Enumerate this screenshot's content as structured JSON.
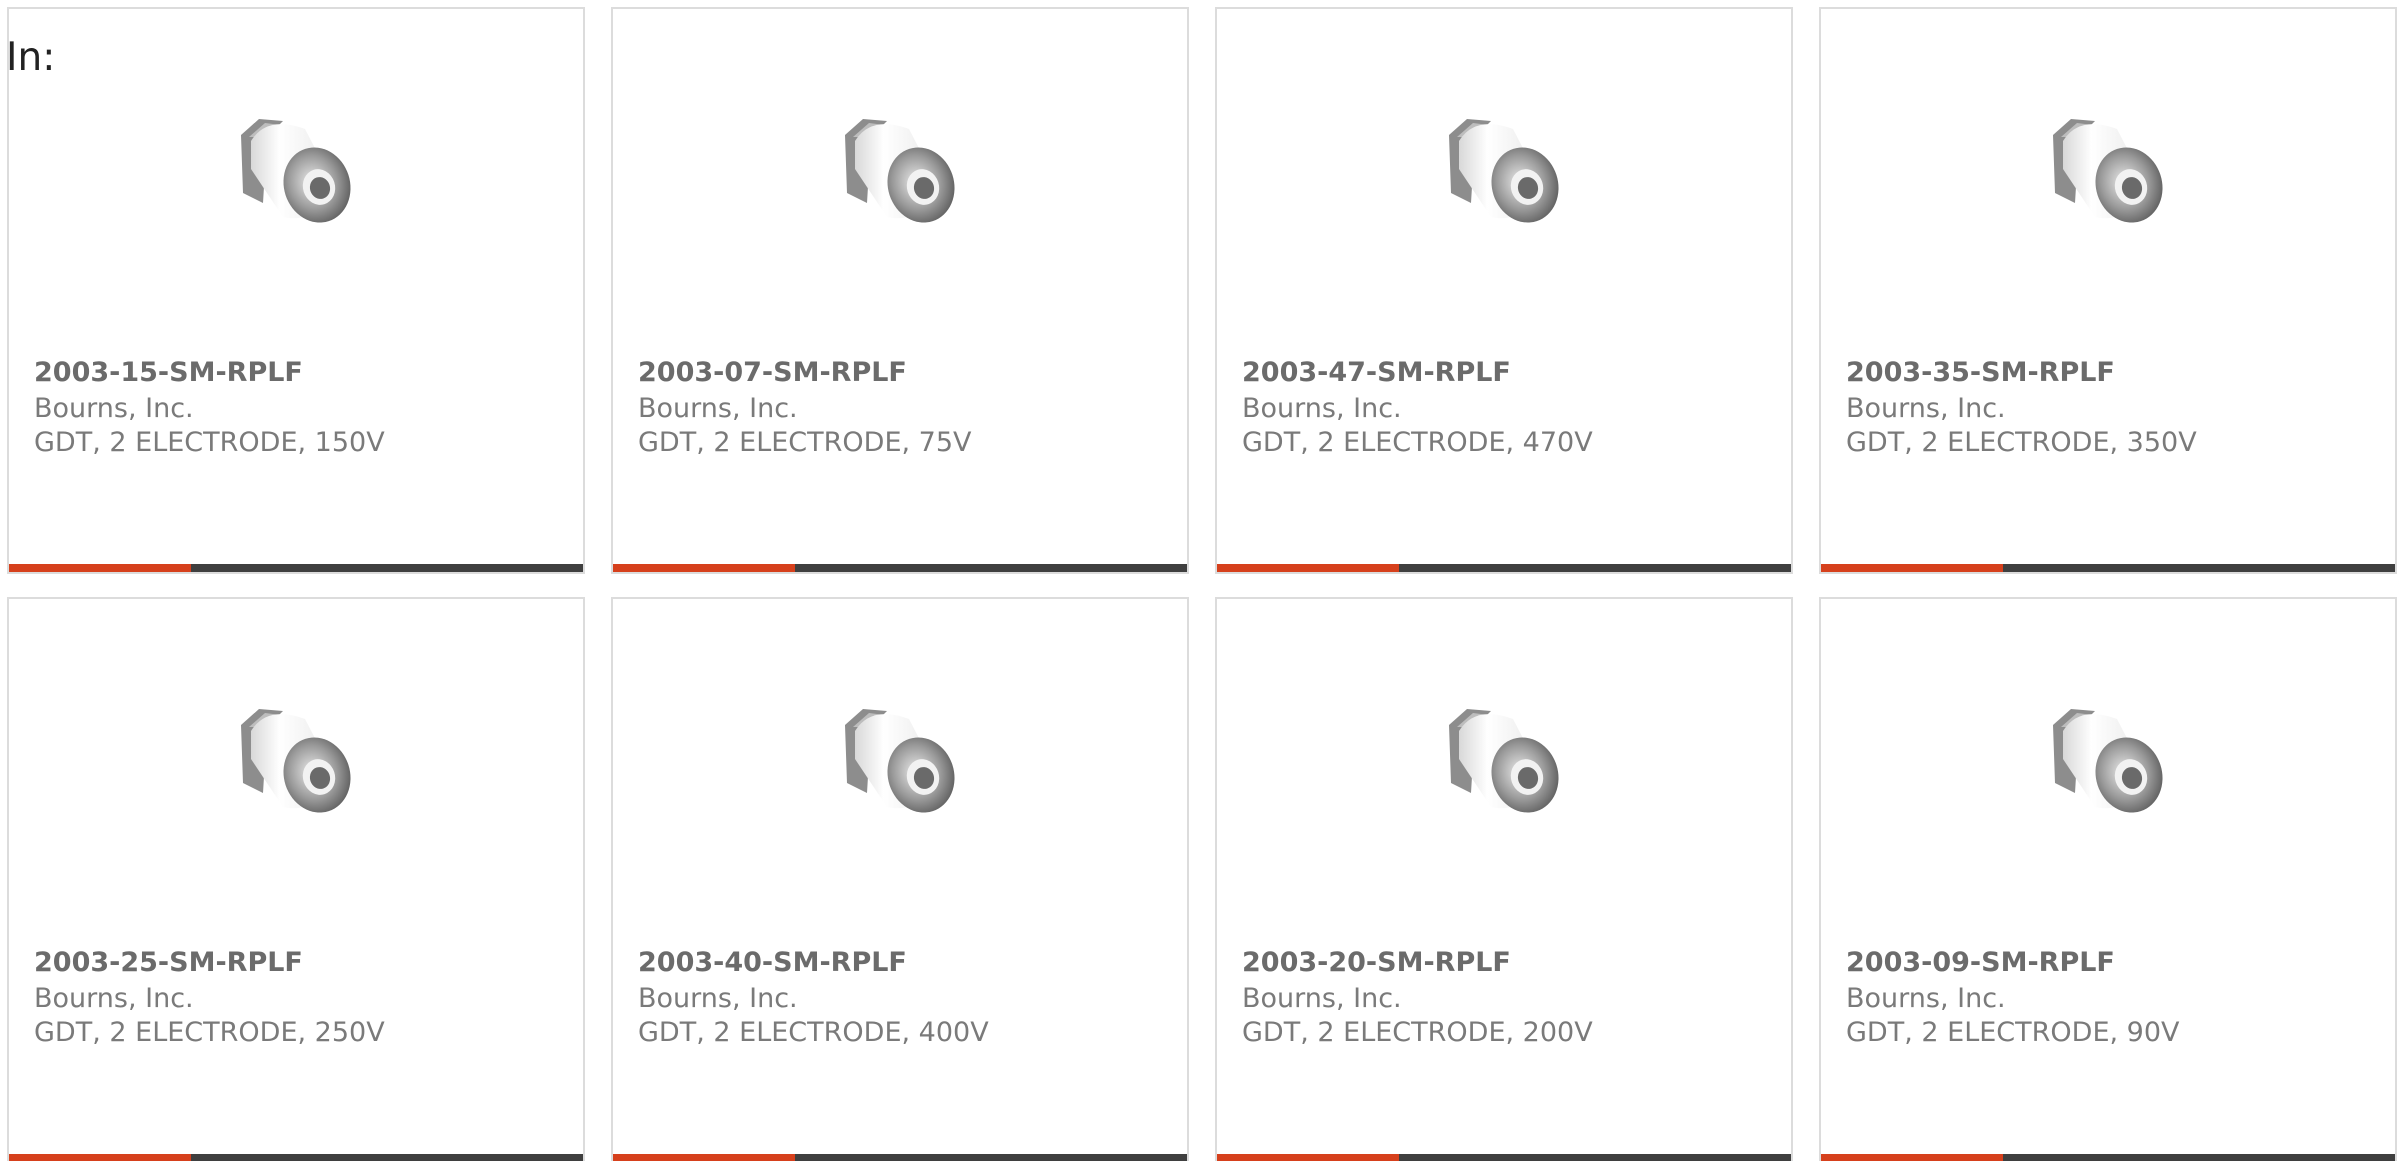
{
  "header": {
    "label": "In:"
  },
  "colors": {
    "accent_bar": "#d6401c",
    "bar": "#3f3f3f",
    "border": "#dcdcdc",
    "part_number_text": "#6b6b6b",
    "body_text": "#7a7a7a"
  },
  "products": [
    {
      "part_number": "2003-15-SM-RPLF",
      "manufacturer": "Bourns, Inc.",
      "description": "GDT, 2 ELECTRODE, 150V",
      "icon": "gas-discharge-tube-icon"
    },
    {
      "part_number": "2003-07-SM-RPLF",
      "manufacturer": "Bourns, Inc.",
      "description": "GDT, 2 ELECTRODE, 75V",
      "icon": "gas-discharge-tube-icon"
    },
    {
      "part_number": "2003-47-SM-RPLF",
      "manufacturer": "Bourns, Inc.",
      "description": "GDT, 2 ELECTRODE, 470V",
      "icon": "gas-discharge-tube-icon"
    },
    {
      "part_number": "2003-35-SM-RPLF",
      "manufacturer": "Bourns, Inc.",
      "description": "GDT, 2 ELECTRODE, 350V",
      "icon": "gas-discharge-tube-icon"
    },
    {
      "part_number": "2003-25-SM-RPLF",
      "manufacturer": "Bourns, Inc.",
      "description": "GDT, 2 ELECTRODE, 250V",
      "icon": "gas-discharge-tube-icon"
    },
    {
      "part_number": "2003-40-SM-RPLF",
      "manufacturer": "Bourns, Inc.",
      "description": "GDT, 2 ELECTRODE, 400V",
      "icon": "gas-discharge-tube-icon"
    },
    {
      "part_number": "2003-20-SM-RPLF",
      "manufacturer": "Bourns, Inc.",
      "description": "GDT, 2 ELECTRODE, 200V",
      "icon": "gas-discharge-tube-icon"
    },
    {
      "part_number": "2003-09-SM-RPLF",
      "manufacturer": "Bourns, Inc.",
      "description": "GDT, 2 ELECTRODE, 90V",
      "icon": "gas-discharge-tube-icon"
    }
  ]
}
